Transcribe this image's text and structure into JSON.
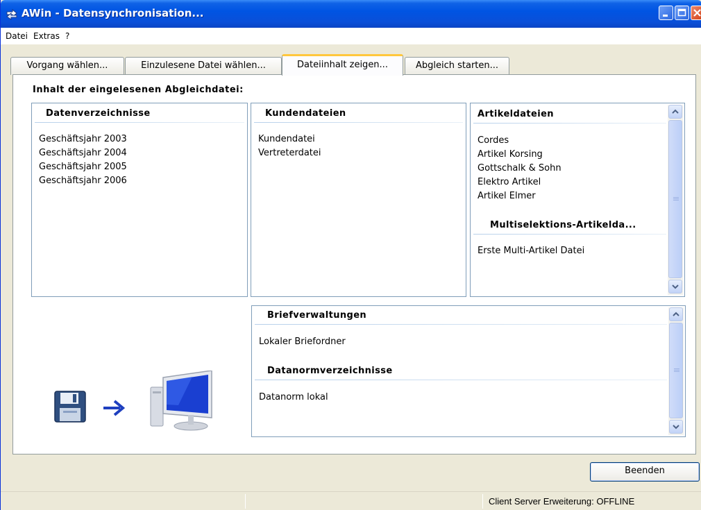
{
  "window": {
    "title": "AWin - Datensynchronisation..."
  },
  "menu": [
    "Datei",
    "Extras",
    "?"
  ],
  "tabs": [
    "Vorgang wählen...",
    "Einzulesene Datei wählen...",
    "Dateiinhalt zeigen...",
    "Abgleich starten..."
  ],
  "active_tab": "Dateiinhalt zeigen...",
  "content": {
    "heading": "Inhalt der eingelesenen Abgleichdatei:",
    "datenverzeichnisse": {
      "title": "Datenverzeichnisse",
      "items": [
        "Geschäftsjahr 2003",
        "Geschäftsjahr 2004",
        "Geschäftsjahr 2005",
        "Geschäftsjahr 2006"
      ]
    },
    "kundendateien": {
      "title": "Kundendateien",
      "items": [
        "Kundendatei",
        "Vertreterdatei"
      ]
    },
    "artikeldateien": {
      "title": "Artikeldateien",
      "items": [
        "Cordes",
        "Artikel Korsing",
        "Gottschalk & Sohn",
        "Elektro Artikel",
        "Artikel Elmer"
      ]
    },
    "multiselektion": {
      "title": "Multiselektions-Artikelda...",
      "items": [
        "Erste Multi-Artikel Datei"
      ]
    },
    "briefverwaltungen": {
      "title": "Briefverwaltungen",
      "items": [
        "Lokaler Briefordner"
      ]
    },
    "datanorm": {
      "title": "Datanormverzeichnisse",
      "items": [
        "Datanorm lokal"
      ]
    }
  },
  "buttons": {
    "beenden": "Beenden"
  },
  "status": {
    "text": "Client Server Erweiterung: OFFLINE"
  },
  "colors": {
    "titlebar": "#0054e3",
    "active_tab_accent": "#ffc73c",
    "panel_border": "#7f9db9"
  },
  "icons": [
    "app-icon",
    "floppy-disk-icon",
    "arrow-right-icon",
    "computer-icon"
  ]
}
